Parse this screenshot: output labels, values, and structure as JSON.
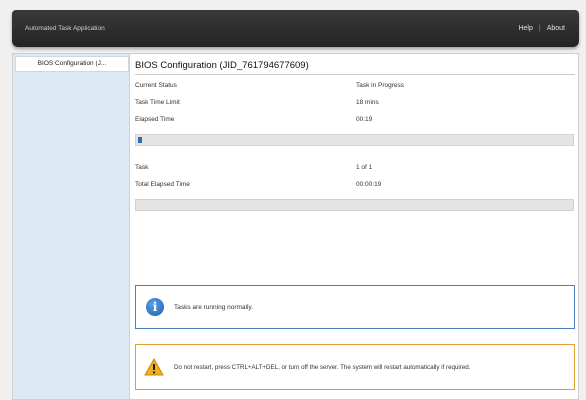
{
  "header": {
    "app_title": "Automated Task Application",
    "help_label": "Help",
    "separator": "|",
    "about_label": "About"
  },
  "sidebar": {
    "items": [
      {
        "label": "BIOS Configuration (J..."
      }
    ]
  },
  "main": {
    "page_title": "BIOS Configuration (JID_761794677609)",
    "status_rows": [
      {
        "label": "Current Status",
        "value": "Task in Progress"
      },
      {
        "label": "Task Time Limit",
        "value": "18 mins"
      },
      {
        "label": "Elapsed Time",
        "value": "00:19"
      }
    ],
    "task_progress_percent": 1,
    "summary_rows": [
      {
        "label": "Task",
        "value": "1 of 1"
      },
      {
        "label": "Total Elapsed Time",
        "value": "00:00:19"
      }
    ],
    "overall_progress_percent": 0
  },
  "info_message": {
    "icon": "info-icon",
    "text": "Tasks are running normally."
  },
  "warning_message": {
    "icon": "warning-icon",
    "text": "Do not restart, press CTRL+ALT+DEL, or turn off the server.  The system will restart automatically if required."
  },
  "colors": {
    "header_bg": "#2b2b2b",
    "sidebar_bg": "#ddeaf4",
    "progress_fill": "#2f6db0",
    "info_border": "#4a7fc0",
    "warning_border": "#e0a030"
  }
}
